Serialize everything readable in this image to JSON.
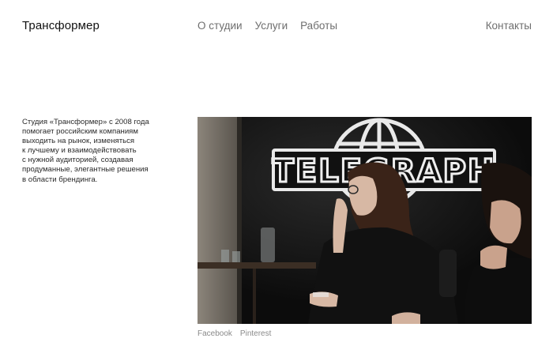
{
  "header": {
    "logo": "Трансформер",
    "nav": [
      {
        "label": "О студии"
      },
      {
        "label": "Услуги"
      },
      {
        "label": "Работы"
      }
    ],
    "contacts": "Контакты"
  },
  "about": {
    "lines": [
      "Студия «Трансформер» с 2008 года",
      "помогает российским компаниям",
      "выходить на рынок, изменяться",
      "к лучшему и взаимодействовать",
      "с нужной аудиторией, создавая",
      "продуманные, элегантные решения",
      "в области брендинга."
    ]
  },
  "photo": {
    "sign_text": "TELEGRAPH"
  },
  "footer": {
    "social": [
      {
        "label": "Facebook"
      },
      {
        "label": "Pinterest"
      }
    ]
  },
  "colors": {
    "text": "#1a1a1a",
    "nav": "#6e6e6e",
    "social": "#8a8a8a",
    "background": "#ffffff"
  }
}
